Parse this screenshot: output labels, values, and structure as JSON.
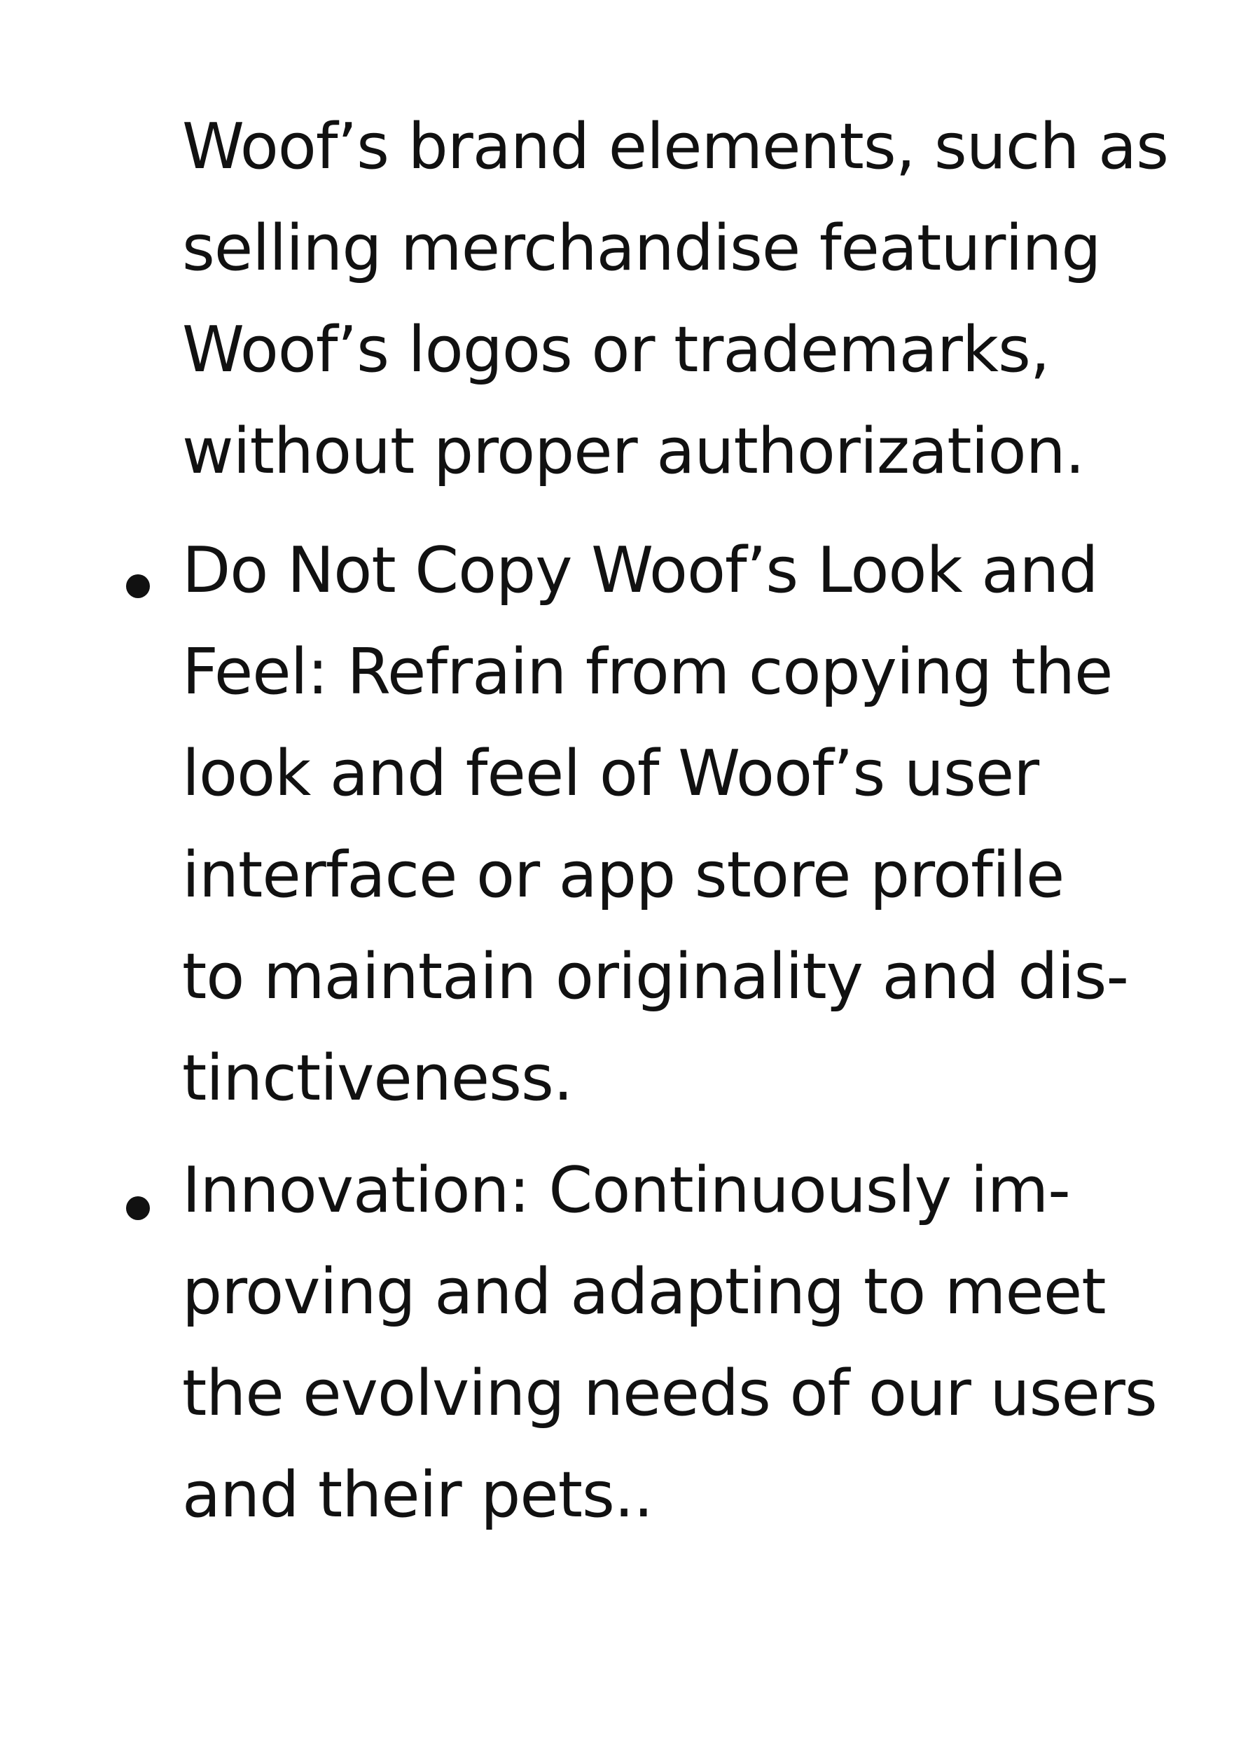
{
  "continuation": {
    "lines": [
      "Woof’s brand elements, such as",
      "selling merchandise featuring",
      "Woof’s logos or trademarks,",
      "without proper authorization."
    ]
  },
  "bullets": [
    {
      "lines": [
        "Do Not Copy Woof’s Look and",
        "Feel: Refrain from copying the",
        "look and feel of Woof’s user",
        "interface or app store profile",
        "to maintain originality and dis-",
        "tinctiveness."
      ]
    },
    {
      "lines": [
        "Innovation: Continuously im-",
        "proving and adapting to meet",
        "the evolving needs of our users",
        "and their pets.."
      ]
    }
  ]
}
